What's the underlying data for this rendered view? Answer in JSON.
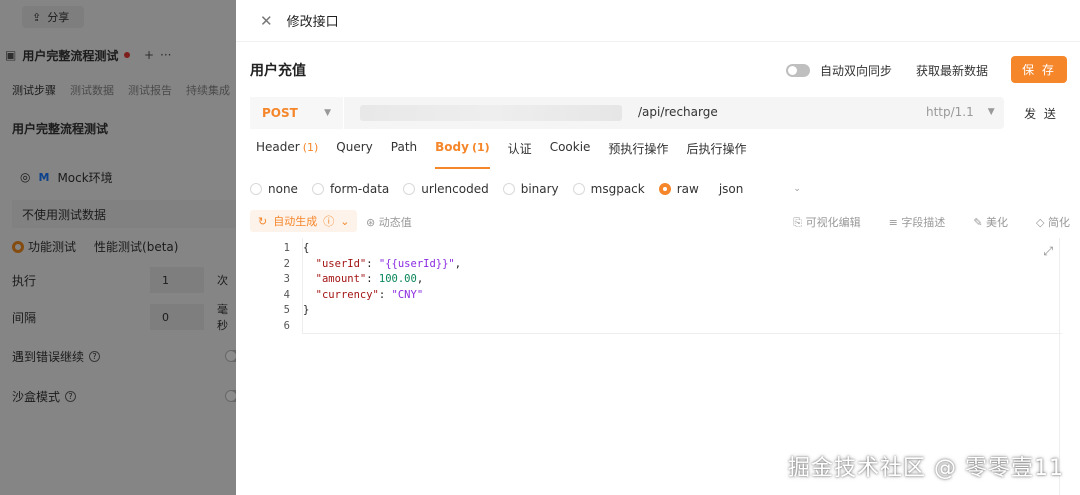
{
  "background": {
    "share_label": "分享",
    "flow_tab_title": "用户完整流程测试",
    "subtabs": [
      "测试步骤",
      "测试数据",
      "测试报告",
      "持续集成"
    ],
    "flow_title": "用户完整流程测试",
    "env_badge": "M",
    "env_name": "Mock环境",
    "test_data_select": "不使用测试数据",
    "mode_functional": "功能测试",
    "mode_performance": "性能测试(beta)",
    "exec_label": "执行",
    "exec_value": "1",
    "exec_unit": "次",
    "interval_label": "间隔",
    "interval_value": "0",
    "interval_unit": "毫秒",
    "continue_on_error": "遇到错误继续",
    "sandbox_mode": "沙盒模式"
  },
  "drawer": {
    "title": "修改接口",
    "api_name": "用户充值",
    "sync_label": "自动双向同步",
    "sync_enabled": false,
    "fetch_label": "获取最新数据",
    "save_label": "保 存",
    "method": "POST",
    "url_path": "/api/recharge",
    "protocol": "http/1.1",
    "send_label": "发 送",
    "tabs": [
      {
        "label": "Header",
        "count": "(1)"
      },
      {
        "label": "Query",
        "count": ""
      },
      {
        "label": "Path",
        "count": ""
      },
      {
        "label": "Body",
        "count": "(1)"
      },
      {
        "label": "认证",
        "count": ""
      },
      {
        "label": "Cookie",
        "count": ""
      },
      {
        "label": "预执行操作",
        "count": ""
      },
      {
        "label": "后执行操作",
        "count": ""
      }
    ],
    "active_tab": "Body",
    "body_types": [
      "none",
      "form-data",
      "urlencoded",
      "binary",
      "msgpack",
      "raw"
    ],
    "selected_body_type": "raw",
    "raw_format": "json",
    "autogen_label": "自动生成",
    "dynamic_value_label": "动态值",
    "tools": [
      "可视化编辑",
      "字段描述",
      "美化",
      "简化"
    ],
    "line_numbers": [
      "1",
      "2",
      "3",
      "4",
      "5",
      "6"
    ],
    "code": {
      "l1": "{",
      "l2_key": "\"userId\"",
      "l2_val": "\"{{userId}}\"",
      "l3_key": "\"amount\"",
      "l3_val": "100.00",
      "l4_key": "\"currency\"",
      "l4_val": "\"CNY\"",
      "l5": "}"
    }
  },
  "watermark": "掘金技术社区 @ 零零壹11",
  "colors": {
    "accent": "#f5862a",
    "overlay": "#8e8e8e"
  }
}
